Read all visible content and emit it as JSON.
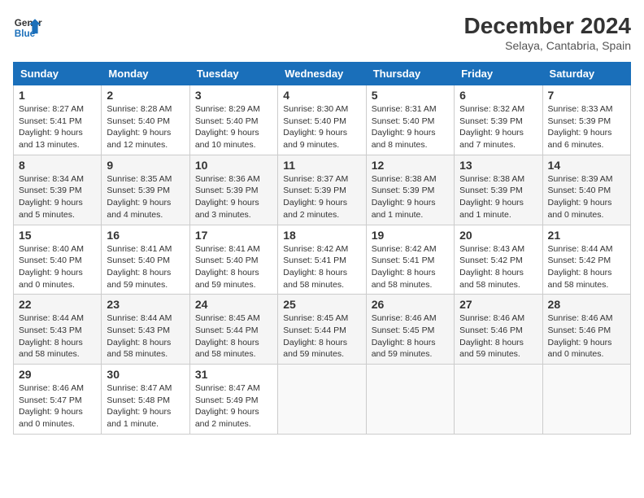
{
  "header": {
    "logo_line1": "General",
    "logo_line2": "Blue",
    "month": "December 2024",
    "location": "Selaya, Cantabria, Spain"
  },
  "weekdays": [
    "Sunday",
    "Monday",
    "Tuesday",
    "Wednesday",
    "Thursday",
    "Friday",
    "Saturday"
  ],
  "weeks": [
    [
      {
        "day": "1",
        "sunrise": "Sunrise: 8:27 AM",
        "sunset": "Sunset: 5:41 PM",
        "daylight": "Daylight: 9 hours and 13 minutes."
      },
      {
        "day": "2",
        "sunrise": "Sunrise: 8:28 AM",
        "sunset": "Sunset: 5:40 PM",
        "daylight": "Daylight: 9 hours and 12 minutes."
      },
      {
        "day": "3",
        "sunrise": "Sunrise: 8:29 AM",
        "sunset": "Sunset: 5:40 PM",
        "daylight": "Daylight: 9 hours and 10 minutes."
      },
      {
        "day": "4",
        "sunrise": "Sunrise: 8:30 AM",
        "sunset": "Sunset: 5:40 PM",
        "daylight": "Daylight: 9 hours and 9 minutes."
      },
      {
        "day": "5",
        "sunrise": "Sunrise: 8:31 AM",
        "sunset": "Sunset: 5:40 PM",
        "daylight": "Daylight: 9 hours and 8 minutes."
      },
      {
        "day": "6",
        "sunrise": "Sunrise: 8:32 AM",
        "sunset": "Sunset: 5:39 PM",
        "daylight": "Daylight: 9 hours and 7 minutes."
      },
      {
        "day": "7",
        "sunrise": "Sunrise: 8:33 AM",
        "sunset": "Sunset: 5:39 PM",
        "daylight": "Daylight: 9 hours and 6 minutes."
      }
    ],
    [
      {
        "day": "8",
        "sunrise": "Sunrise: 8:34 AM",
        "sunset": "Sunset: 5:39 PM",
        "daylight": "Daylight: 9 hours and 5 minutes."
      },
      {
        "day": "9",
        "sunrise": "Sunrise: 8:35 AM",
        "sunset": "Sunset: 5:39 PM",
        "daylight": "Daylight: 9 hours and 4 minutes."
      },
      {
        "day": "10",
        "sunrise": "Sunrise: 8:36 AM",
        "sunset": "Sunset: 5:39 PM",
        "daylight": "Daylight: 9 hours and 3 minutes."
      },
      {
        "day": "11",
        "sunrise": "Sunrise: 8:37 AM",
        "sunset": "Sunset: 5:39 PM",
        "daylight": "Daylight: 9 hours and 2 minutes."
      },
      {
        "day": "12",
        "sunrise": "Sunrise: 8:38 AM",
        "sunset": "Sunset: 5:39 PM",
        "daylight": "Daylight: 9 hours and 1 minute."
      },
      {
        "day": "13",
        "sunrise": "Sunrise: 8:38 AM",
        "sunset": "Sunset: 5:39 PM",
        "daylight": "Daylight: 9 hours and 1 minute."
      },
      {
        "day": "14",
        "sunrise": "Sunrise: 8:39 AM",
        "sunset": "Sunset: 5:40 PM",
        "daylight": "Daylight: 9 hours and 0 minutes."
      }
    ],
    [
      {
        "day": "15",
        "sunrise": "Sunrise: 8:40 AM",
        "sunset": "Sunset: 5:40 PM",
        "daylight": "Daylight: 9 hours and 0 minutes."
      },
      {
        "day": "16",
        "sunrise": "Sunrise: 8:41 AM",
        "sunset": "Sunset: 5:40 PM",
        "daylight": "Daylight: 8 hours and 59 minutes."
      },
      {
        "day": "17",
        "sunrise": "Sunrise: 8:41 AM",
        "sunset": "Sunset: 5:40 PM",
        "daylight": "Daylight: 8 hours and 59 minutes."
      },
      {
        "day": "18",
        "sunrise": "Sunrise: 8:42 AM",
        "sunset": "Sunset: 5:41 PM",
        "daylight": "Daylight: 8 hours and 58 minutes."
      },
      {
        "day": "19",
        "sunrise": "Sunrise: 8:42 AM",
        "sunset": "Sunset: 5:41 PM",
        "daylight": "Daylight: 8 hours and 58 minutes."
      },
      {
        "day": "20",
        "sunrise": "Sunrise: 8:43 AM",
        "sunset": "Sunset: 5:42 PM",
        "daylight": "Daylight: 8 hours and 58 minutes."
      },
      {
        "day": "21",
        "sunrise": "Sunrise: 8:44 AM",
        "sunset": "Sunset: 5:42 PM",
        "daylight": "Daylight: 8 hours and 58 minutes."
      }
    ],
    [
      {
        "day": "22",
        "sunrise": "Sunrise: 8:44 AM",
        "sunset": "Sunset: 5:43 PM",
        "daylight": "Daylight: 8 hours and 58 minutes."
      },
      {
        "day": "23",
        "sunrise": "Sunrise: 8:44 AM",
        "sunset": "Sunset: 5:43 PM",
        "daylight": "Daylight: 8 hours and 58 minutes."
      },
      {
        "day": "24",
        "sunrise": "Sunrise: 8:45 AM",
        "sunset": "Sunset: 5:44 PM",
        "daylight": "Daylight: 8 hours and 58 minutes."
      },
      {
        "day": "25",
        "sunrise": "Sunrise: 8:45 AM",
        "sunset": "Sunset: 5:44 PM",
        "daylight": "Daylight: 8 hours and 59 minutes."
      },
      {
        "day": "26",
        "sunrise": "Sunrise: 8:46 AM",
        "sunset": "Sunset: 5:45 PM",
        "daylight": "Daylight: 8 hours and 59 minutes."
      },
      {
        "day": "27",
        "sunrise": "Sunrise: 8:46 AM",
        "sunset": "Sunset: 5:46 PM",
        "daylight": "Daylight: 8 hours and 59 minutes."
      },
      {
        "day": "28",
        "sunrise": "Sunrise: 8:46 AM",
        "sunset": "Sunset: 5:46 PM",
        "daylight": "Daylight: 9 hours and 0 minutes."
      }
    ],
    [
      {
        "day": "29",
        "sunrise": "Sunrise: 8:46 AM",
        "sunset": "Sunset: 5:47 PM",
        "daylight": "Daylight: 9 hours and 0 minutes."
      },
      {
        "day": "30",
        "sunrise": "Sunrise: 8:47 AM",
        "sunset": "Sunset: 5:48 PM",
        "daylight": "Daylight: 9 hours and 1 minute."
      },
      {
        "day": "31",
        "sunrise": "Sunrise: 8:47 AM",
        "sunset": "Sunset: 5:49 PM",
        "daylight": "Daylight: 9 hours and 2 minutes."
      },
      null,
      null,
      null,
      null
    ]
  ]
}
